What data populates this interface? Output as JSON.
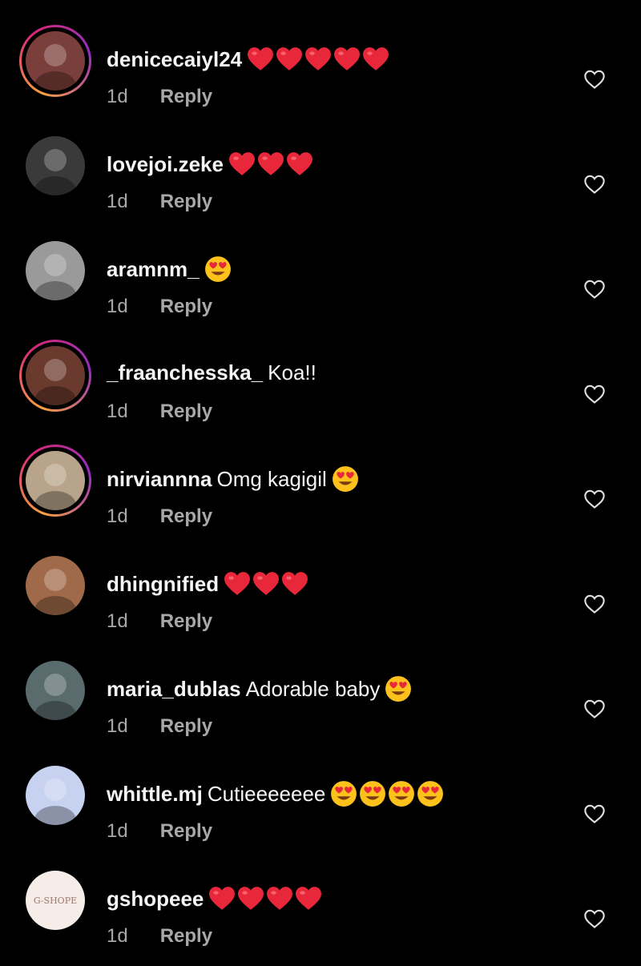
{
  "comments": [
    {
      "username": "denicecaiyl24",
      "text": "",
      "emojis": [
        "heart",
        "heart",
        "heart",
        "heart",
        "heart"
      ],
      "time": "1d",
      "reply": "Reply",
      "story_ring": true,
      "avatar_color": "#7a3f3a"
    },
    {
      "username": "lovejoi.zeke",
      "text": "",
      "emojis": [
        "heart",
        "heart",
        "heart"
      ],
      "time": "1d",
      "reply": "Reply",
      "story_ring": false,
      "avatar_color": "#3a3a3a"
    },
    {
      "username": "aramnm_",
      "text": "",
      "emojis": [
        "heart-eyes"
      ],
      "time": "1d",
      "reply": "Reply",
      "story_ring": false,
      "avatar_color": "#9a9a9a"
    },
    {
      "username": "_fraanchesska_",
      "text": "Koa!!",
      "emojis": [],
      "time": "1d",
      "reply": "Reply",
      "story_ring": true,
      "avatar_color": "#6b3a2e"
    },
    {
      "username": "nirviannna",
      "text": "Omg kagigil",
      "emojis": [
        "heart-eyes"
      ],
      "time": "1d",
      "reply": "Reply",
      "story_ring": true,
      "avatar_color": "#b8a48a"
    },
    {
      "username": "dhingnified",
      "text": "",
      "emojis": [
        "heart",
        "heart",
        "heart"
      ],
      "time": "1d",
      "reply": "Reply",
      "story_ring": false,
      "avatar_color": "#a06a4a"
    },
    {
      "username": "maria_dublas",
      "text": "Adorable baby",
      "emojis": [
        "heart-eyes"
      ],
      "time": "1d",
      "reply": "Reply",
      "story_ring": false,
      "avatar_color": "#5a6b6e"
    },
    {
      "username": "whittle.mj",
      "text": "Cutieeeeeee",
      "emojis": [
        "heart-eyes",
        "heart-eyes",
        "heart-eyes",
        "heart-eyes"
      ],
      "time": "1d",
      "reply": "Reply",
      "story_ring": false,
      "avatar_color": "#c7d2f0"
    },
    {
      "username": "gshopeee",
      "text": "",
      "emojis": [
        "heart",
        "heart",
        "heart",
        "heart"
      ],
      "time": "1d",
      "reply": "Reply",
      "story_ring": false,
      "avatar_color": "#f6ece8",
      "avatar_text": "G-SHOPE"
    }
  ],
  "colors": {
    "background": "#000000",
    "text": "#f5f5f5",
    "meta": "#a8a8a8",
    "heart": "#e8283a"
  }
}
